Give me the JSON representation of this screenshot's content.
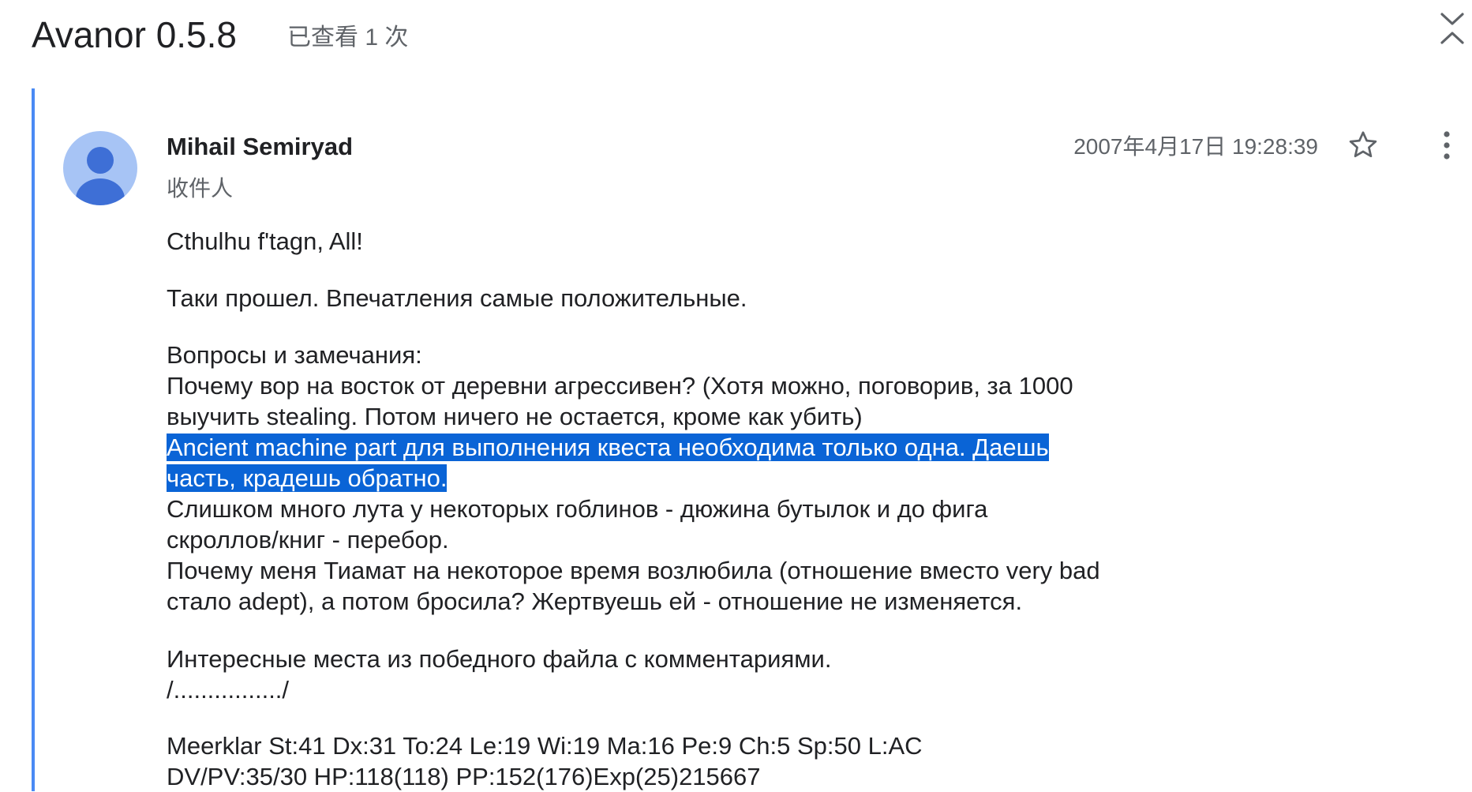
{
  "thread": {
    "title": "Avanor 0.5.8",
    "view_count": "已查看 1 次"
  },
  "message": {
    "sender": "Mihail Semiryad",
    "recipient_label": "收件人",
    "timestamp": "2007年4月17日 19:28:39",
    "body": {
      "greeting": "Cthulhu f'tagn, All!",
      "impression": "Таки прошел. Впечатления самые положительные.",
      "questions_header": "Вопросы и замечания:",
      "q1_line1": "Почему вор на восток от деревни агрессивен? (Хотя можно, поговорив, за 1000",
      "q1_line2": "выучить stealing. Потом ничего не остается, кроме как убить)",
      "q2_line1": "Ancient machine part для выполнения квеста необходима только одна. Даешь",
      "q2_line2": "часть, крадешь обратно.",
      "q3_line1": "Слишком много лута у некоторых гоблинов - дюжина бутылок и до фига",
      "q3_line2": "скроллов/книг - перебор.",
      "q4_line1": "Почему меня Тиамат на некоторое время возлюбила (отношение вместо very bad",
      "q4_line2": "стало adept), а потом бросила? Жертвуешь ей - отношение не изменяется.",
      "places_header": "Интересные места из победного файла с комментариями.",
      "separator": "/................/",
      "stats_line1": "Meerklar St:41 Dx:31 To:24 Le:19 Wi:19 Ma:16 Pe:9 Ch:5 Sp:50 L:AC",
      "stats_line2": "DV/PV:35/30 HP:118(118) PP:152(176)Exp(25)215667"
    }
  },
  "icons": {
    "collapse": "collapse-all-icon",
    "star": "star-outline-icon",
    "more": "more-vert-icon",
    "avatar": "person-avatar-icon"
  },
  "colors": {
    "thread_bar": "#4a8af4",
    "avatar_bg": "#a7c4f5",
    "avatar_fg": "#3e6fd6",
    "selection": "#0a64d6"
  }
}
